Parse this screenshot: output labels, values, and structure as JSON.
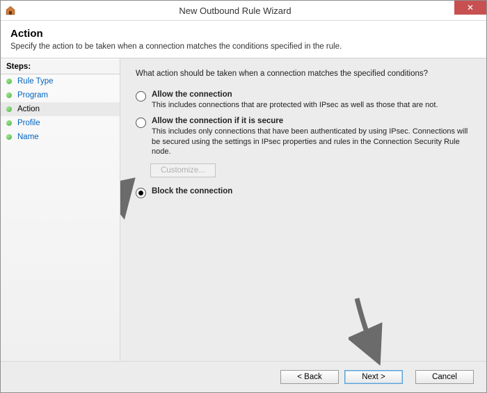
{
  "window": {
    "title": "New Outbound Rule Wizard",
    "close_symbol": "✕"
  },
  "header": {
    "title": "Action",
    "subtitle": "Specify the action to be taken when a connection matches the conditions specified in the rule."
  },
  "sidebar": {
    "title": "Steps:",
    "items": [
      {
        "label": "Rule Type",
        "current": false
      },
      {
        "label": "Program",
        "current": false
      },
      {
        "label": "Action",
        "current": true
      },
      {
        "label": "Profile",
        "current": false
      },
      {
        "label": "Name",
        "current": false
      }
    ]
  },
  "content": {
    "prompt": "What action should be taken when a connection matches the specified conditions?",
    "options": [
      {
        "title": "Allow the connection",
        "desc": "This includes connections that are protected with IPsec as well as those that are not.",
        "checked": false
      },
      {
        "title": "Allow the connection if it is secure",
        "desc": "This includes only connections that have been authenticated by using IPsec.  Connections will be secured using the settings in IPsec properties and rules in the Connection Security Rule node.",
        "checked": false
      },
      {
        "title": "Block the connection",
        "desc": "",
        "checked": true
      }
    ],
    "customize_label": "Customize...",
    "customize_enabled": false
  },
  "footer": {
    "back": "< Back",
    "next": "Next >",
    "cancel": "Cancel"
  }
}
